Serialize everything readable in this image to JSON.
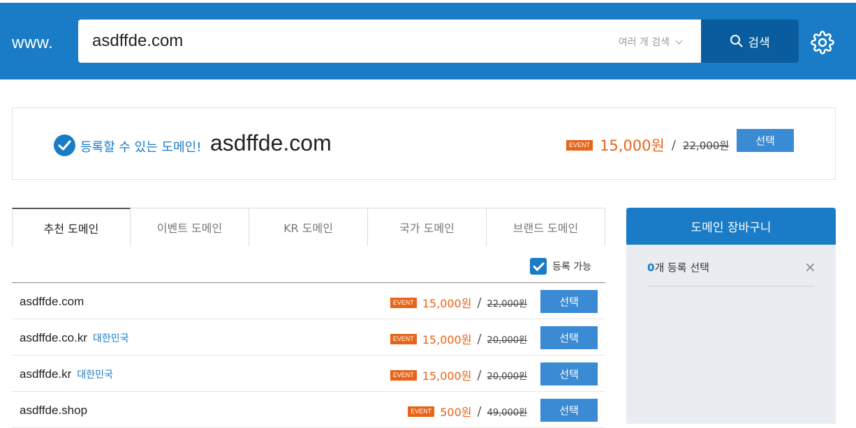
{
  "header": {
    "prefix": "www.",
    "search_value": "asdffde.com",
    "multi_search_label": "여러 개 검색",
    "search_button_label": "검색"
  },
  "result": {
    "status_label": "등록할 수 있는 도메인!",
    "domain": "asdffde.com",
    "badge": "EVENT",
    "price": "15,000원",
    "slash": "/",
    "original_price": "22,000원",
    "select_label": "선택"
  },
  "tabs": [
    {
      "label": "추천 도메인",
      "active": true
    },
    {
      "label": "이벤트 도메인",
      "active": false
    },
    {
      "label": "KR 도메인",
      "active": false
    },
    {
      "label": "국가 도메인",
      "active": false
    },
    {
      "label": "브랜드 도메인",
      "active": false
    }
  ],
  "filter": {
    "label": "등록 가능",
    "checked": true
  },
  "rows": [
    {
      "domain": "asdffde.com",
      "country": "",
      "badge": "EVENT",
      "price": "15,000원",
      "slash": "/",
      "original_price": "22,000원",
      "select_label": "선택"
    },
    {
      "domain": "asdffde.co.kr",
      "country": "대한민국",
      "badge": "EVENT",
      "price": "15,000원",
      "slash": "/",
      "original_price": "20,000원",
      "select_label": "선택"
    },
    {
      "domain": "asdffde.kr",
      "country": "대한민국",
      "badge": "EVENT",
      "price": "15,000원",
      "slash": "/",
      "original_price": "20,000원",
      "select_label": "선택"
    },
    {
      "domain": "asdffde.shop",
      "country": "",
      "badge": "EVENT",
      "price": "500원",
      "slash": "/",
      "original_price": "49,000원",
      "select_label": "선택"
    }
  ],
  "cart": {
    "title": "도메인 장바구니",
    "count": "0",
    "count_suffix": "개 등록 선택",
    "clear_symbol": "×"
  },
  "colors": {
    "brand_blue": "#1a7bc6",
    "dark_blue": "#095d9e",
    "event_orange": "#e8641a"
  }
}
